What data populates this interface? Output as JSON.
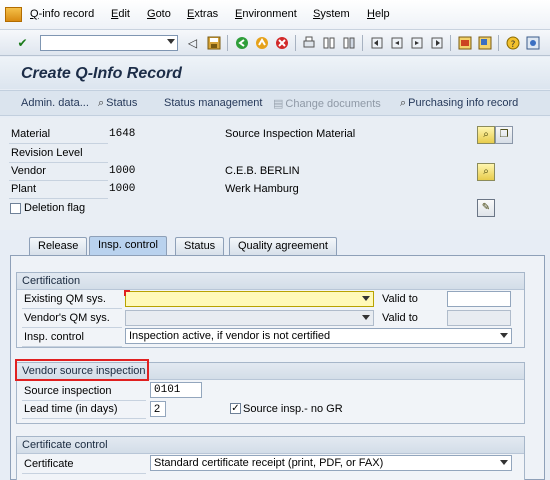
{
  "menu": [
    "Q-info record",
    "Edit",
    "Goto",
    "Extras",
    "Environment",
    "System",
    "Help"
  ],
  "page_title": "Create Q-Info Record",
  "app_toolbar": {
    "admin_data": "Admin. data...",
    "status": "Status",
    "status_management": "Status management",
    "change_documents": "Change documents",
    "purchasing_info_record": "Purchasing info record"
  },
  "header": {
    "material_label": "Material",
    "material_value": "1648",
    "material_desc": "Source Inspection Material",
    "revision_label": "Revision Level",
    "vendor_label": "Vendor",
    "vendor_value": "1000",
    "vendor_desc": "C.E.B. BERLIN",
    "plant_label": "Plant",
    "plant_value": "1000",
    "plant_desc": "Werk Hamburg",
    "deletion_flag_label": "Deletion flag"
  },
  "tabs": [
    "Release",
    "Insp. control",
    "Status",
    "Quality agreement"
  ],
  "certification": {
    "title": "Certification",
    "existing_qm_label": "Existing QM sys.",
    "existing_qm_value": "",
    "vendors_qm_label": "Vendor's QM sys.",
    "vendors_qm_value": "",
    "valid_to_label": "Valid to",
    "insp_control_label": "Insp. control",
    "insp_control_value": "Inspection active, if vendor is not certified"
  },
  "vendor_source": {
    "title": "Vendor source inspection",
    "source_insp_label": "Source inspection",
    "source_insp_value": "0101",
    "lead_time_label": "Lead time (in days)",
    "lead_time_value": "2",
    "no_gr_label": "Source insp.- no GR",
    "no_gr_checked": true
  },
  "certificate_control": {
    "title": "Certificate control",
    "certificate_label": "Certificate",
    "certificate_value": "Standard certificate receipt (print, PDF, or FAX)"
  },
  "icons": {
    "enter": "check-icon",
    "save": "save-icon",
    "back": "back-icon",
    "exit": "exit-icon",
    "cancel": "cancel-icon"
  },
  "colors": {
    "highlight_frame": "#e02020",
    "required_field": "#fff9b8",
    "active_tab": "#b9d2ee"
  }
}
